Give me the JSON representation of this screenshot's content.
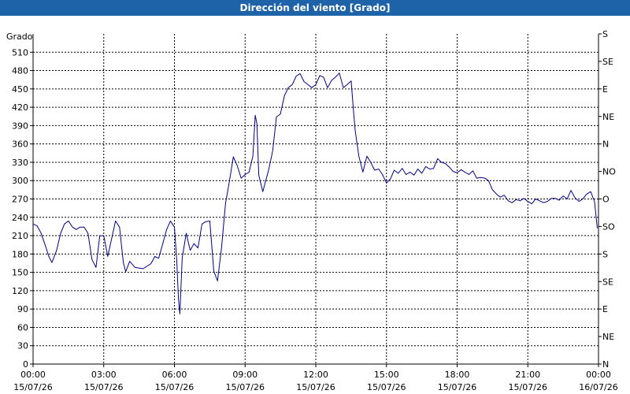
{
  "chart_data": {
    "type": "line",
    "title": "Dirección del viento [Grado]",
    "ylabel": "Grado",
    "ylim": [
      0,
      540
    ],
    "yticks": [
      0,
      30,
      60,
      90,
      120,
      150,
      180,
      210,
      240,
      270,
      300,
      330,
      360,
      390,
      420,
      450,
      480,
      510
    ],
    "xlim": [
      0,
      24
    ],
    "xticks": [
      {
        "time": "00:00",
        "date": "15/07/26",
        "h": 0
      },
      {
        "time": "03:00",
        "date": "15/07/26",
        "h": 3
      },
      {
        "time": "06:00",
        "date": "15/07/26",
        "h": 6
      },
      {
        "time": "09:00",
        "date": "15/07/26",
        "h": 9
      },
      {
        "time": "12:00",
        "date": "15/07/26",
        "h": 12
      },
      {
        "time": "15:00",
        "date": "15/07/26",
        "h": 15
      },
      {
        "time": "18:00",
        "date": "15/07/26",
        "h": 18
      },
      {
        "time": "21:00",
        "date": "15/07/26",
        "h": 21
      },
      {
        "time": "00:00",
        "date": "16/07/26",
        "h": 24
      }
    ],
    "right_axis": {
      "labels": [
        {
          "label": "S",
          "value": 540
        },
        {
          "label": "SE",
          "value": 495
        },
        {
          "label": "E",
          "value": 450
        },
        {
          "label": "NE",
          "value": 405
        },
        {
          "label": "N",
          "value": 360
        },
        {
          "label": "NO",
          "value": 315
        },
        {
          "label": "O",
          "value": 270
        },
        {
          "label": "SO",
          "value": 225
        },
        {
          "label": "S",
          "value": 180
        },
        {
          "label": "SE",
          "value": 135
        },
        {
          "label": "E",
          "value": 90
        },
        {
          "label": "NE",
          "value": 45
        },
        {
          "label": "N",
          "value": 0
        }
      ]
    },
    "grid": true,
    "series": [
      {
        "color": "#00008b",
        "points": [
          [
            0.0,
            229
          ],
          [
            0.17,
            226
          ],
          [
            0.33,
            215
          ],
          [
            0.5,
            196
          ],
          [
            0.67,
            176
          ],
          [
            0.8,
            166
          ],
          [
            1.0,
            186
          ],
          [
            1.17,
            214
          ],
          [
            1.33,
            229
          ],
          [
            1.5,
            234
          ],
          [
            1.67,
            224
          ],
          [
            1.83,
            220
          ],
          [
            2.0,
            224
          ],
          [
            2.17,
            224
          ],
          [
            2.33,
            214
          ],
          [
            2.5,
            171
          ],
          [
            2.67,
            158
          ],
          [
            2.83,
            210
          ],
          [
            3.0,
            210
          ],
          [
            3.17,
            176
          ],
          [
            3.33,
            204
          ],
          [
            3.5,
            234
          ],
          [
            3.67,
            224
          ],
          [
            3.83,
            166
          ],
          [
            3.93,
            151
          ],
          [
            4.1,
            168
          ],
          [
            4.33,
            158
          ],
          [
            4.67,
            156
          ],
          [
            5.0,
            164
          ],
          [
            5.17,
            176
          ],
          [
            5.33,
            173
          ],
          [
            5.5,
            196
          ],
          [
            5.67,
            220
          ],
          [
            5.83,
            234
          ],
          [
            6.0,
            224
          ],
          [
            6.1,
            168
          ],
          [
            6.17,
            107
          ],
          [
            6.23,
            82
          ],
          [
            6.33,
            174
          ],
          [
            6.5,
            214
          ],
          [
            6.67,
            186
          ],
          [
            6.83,
            197
          ],
          [
            7.0,
            190
          ],
          [
            7.17,
            229
          ],
          [
            7.33,
            233
          ],
          [
            7.5,
            234
          ],
          [
            7.67,
            152
          ],
          [
            7.83,
            136
          ],
          [
            8.0,
            190
          ],
          [
            8.17,
            263
          ],
          [
            8.33,
            298
          ],
          [
            8.5,
            339
          ],
          [
            8.67,
            324
          ],
          [
            8.83,
            304
          ],
          [
            9.0,
            310
          ],
          [
            9.17,
            314
          ],
          [
            9.33,
            340
          ],
          [
            9.43,
            407
          ],
          [
            9.5,
            393
          ],
          [
            9.58,
            309
          ],
          [
            9.75,
            282
          ],
          [
            10.0,
            318
          ],
          [
            10.17,
            349
          ],
          [
            10.33,
            404
          ],
          [
            10.5,
            409
          ],
          [
            10.67,
            439
          ],
          [
            10.83,
            452
          ],
          [
            11.0,
            457
          ],
          [
            11.17,
            471
          ],
          [
            11.33,
            475
          ],
          [
            11.5,
            462
          ],
          [
            11.67,
            457
          ],
          [
            11.83,
            452
          ],
          [
            12.0,
            457
          ],
          [
            12.17,
            472
          ],
          [
            12.33,
            469
          ],
          [
            12.5,
            452
          ],
          [
            12.67,
            464
          ],
          [
            12.83,
            469
          ],
          [
            13.0,
            476
          ],
          [
            13.17,
            452
          ],
          [
            13.33,
            457
          ],
          [
            13.5,
            463
          ],
          [
            13.6,
            414
          ],
          [
            13.67,
            382
          ],
          [
            13.83,
            340
          ],
          [
            14.0,
            314
          ],
          [
            14.17,
            340
          ],
          [
            14.33,
            330
          ],
          [
            14.5,
            317
          ],
          [
            14.67,
            319
          ],
          [
            14.83,
            310
          ],
          [
            15.0,
            296
          ],
          [
            15.17,
            303
          ],
          [
            15.33,
            317
          ],
          [
            15.5,
            312
          ],
          [
            15.67,
            320
          ],
          [
            15.83,
            310
          ],
          [
            16.0,
            314
          ],
          [
            16.17,
            309
          ],
          [
            16.33,
            319
          ],
          [
            16.5,
            312
          ],
          [
            16.67,
            323
          ],
          [
            16.83,
            319
          ],
          [
            17.0,
            320
          ],
          [
            17.17,
            336
          ],
          [
            17.33,
            330
          ],
          [
            17.5,
            328
          ],
          [
            17.67,
            322
          ],
          [
            17.83,
            315
          ],
          [
            18.0,
            313
          ],
          [
            18.17,
            318
          ],
          [
            18.33,
            314
          ],
          [
            18.5,
            310
          ],
          [
            18.67,
            316
          ],
          [
            18.83,
            304
          ],
          [
            19.0,
            305
          ],
          [
            19.17,
            304
          ],
          [
            19.33,
            300
          ],
          [
            19.5,
            285
          ],
          [
            19.67,
            278
          ],
          [
            19.83,
            273
          ],
          [
            20.0,
            276
          ],
          [
            20.17,
            267
          ],
          [
            20.33,
            264
          ],
          [
            20.5,
            269
          ],
          [
            20.67,
            267
          ],
          [
            20.83,
            271
          ],
          [
            21.0,
            266
          ],
          [
            21.17,
            262
          ],
          [
            21.33,
            270
          ],
          [
            21.5,
            267
          ],
          [
            21.67,
            264
          ],
          [
            21.83,
            266
          ],
          [
            22.0,
            271
          ],
          [
            22.17,
            271
          ],
          [
            22.33,
            268
          ],
          [
            22.5,
            275
          ],
          [
            22.67,
            270
          ],
          [
            22.83,
            284
          ],
          [
            23.0,
            272
          ],
          [
            23.17,
            266
          ],
          [
            23.33,
            270
          ],
          [
            23.5,
            278
          ],
          [
            23.67,
            282
          ],
          [
            23.83,
            266
          ],
          [
            23.95,
            222
          ]
        ]
      }
    ]
  }
}
